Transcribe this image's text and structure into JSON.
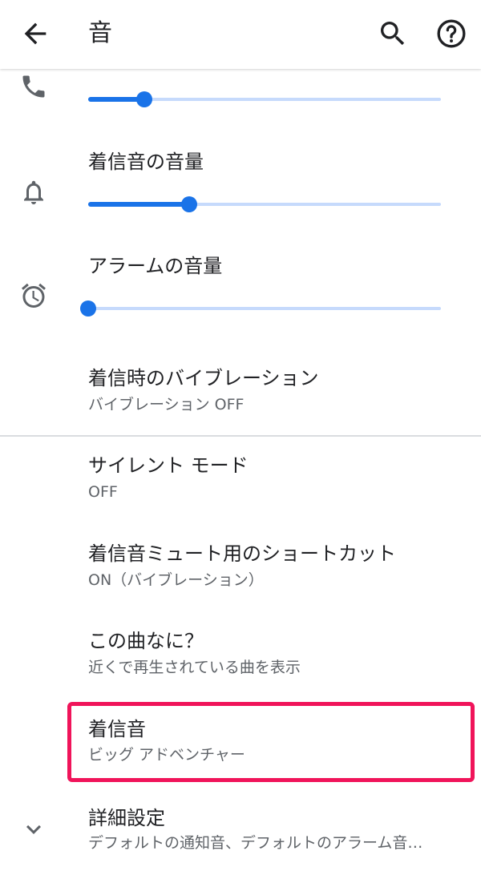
{
  "appbar": {
    "title": "音",
    "back_icon": "arrow-back-icon",
    "search_icon": "search-icon",
    "help_icon": "help-circle-icon"
  },
  "volumes": [
    {
      "icon": "phone-icon",
      "label": "",
      "level": 0.16
    },
    {
      "icon": "bell-icon",
      "label": "着信音の音量",
      "level": 0.286
    },
    {
      "icon": "alarm-clock-icon",
      "label": "アラームの音量",
      "level": 0.0
    }
  ],
  "settings": {
    "vibration": {
      "title": "着信時のバイブレーション",
      "subtitle": "バイブレーション OFF"
    },
    "silent": {
      "title": "サイレント モード",
      "subtitle": "OFF"
    },
    "mute_shortcut": {
      "title": "着信音ミュート用のショートカット",
      "subtitle": "ON（バイブレーション）"
    },
    "now_playing": {
      "title": "この曲なに？",
      "subtitle": "近くで再生されている曲を表示"
    },
    "ringtone": {
      "title": "着信音",
      "subtitle": "ビッグ アドベンチャー"
    },
    "advanced": {
      "title": "詳細設定",
      "subtitle": "デフォルトの通知音、デフォルトのアラーム音…",
      "icon": "chevron-down-icon"
    }
  },
  "colors": {
    "accent": "#1a73e8",
    "highlight": "#f0145a"
  }
}
